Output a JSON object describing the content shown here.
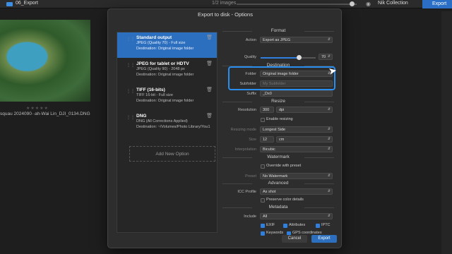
{
  "app": {
    "folder_name": "06_Export",
    "image_count": "1/2 images",
    "nik_label": "Nik Collection",
    "export_tab": "Export",
    "thumbnail_filename": "squau 2024090··ah-Wai Lin_DJI_0134.DNG",
    "thumbnail_stars": "★★★★★"
  },
  "dialog": {
    "title": "Export to disk - Options",
    "add_option": "Add New Option",
    "cancel_label": "Cancel",
    "export_label": "Export"
  },
  "presets": [
    {
      "name": "Standard output",
      "line1": "JPEG (Quality 70) - Full size",
      "line2": "Destination: Original image folder",
      "selected": true
    },
    {
      "name": "JPEG for tablet or HDTV",
      "line1": "JPEG (Quality 90) - 2048 px",
      "line2": "Destination: Original image folder",
      "selected": false
    },
    {
      "name": "TIFF (16-bits)",
      "line1": "TIFF 16-bit - Full size",
      "line2": "Destination: Original image folder",
      "selected": false
    },
    {
      "name": "DNG",
      "line1": "DNG (All Corrections Applied)",
      "line2": "Destination: ~/Volumes/Photo Library/You1",
      "selected": false
    }
  ],
  "format": {
    "section": "Format",
    "action_label": "Action",
    "action_value": "Export as JPEG",
    "quality_label": "Quality",
    "quality_value": "70",
    "quality_fraction": 0.7
  },
  "destination": {
    "section": "Destination",
    "folder_label": "Folder",
    "folder_value": "Original image folder",
    "subfolder_label": "Subfolder",
    "subfolder_placeholder": "My Subfolder",
    "suffix_label": "Suffix",
    "suffix_value": "_Dx0"
  },
  "resize": {
    "section": "Resize",
    "resolution_label": "Resolution",
    "resolution_value": "300",
    "resolution_unit": "dpi",
    "enable_label": "Enable resizing",
    "mode_label": "Resizing mode",
    "mode_value": "Longest Side",
    "size_label": "Size",
    "size_value": "12",
    "size_unit": "cm",
    "interp_label": "Interpolation",
    "interp_value": "Bicubic"
  },
  "watermark": {
    "section": "Watermark",
    "override_label": "Override with preset",
    "preset_label": "Preset",
    "preset_value": "No Watermark"
  },
  "advanced": {
    "section": "Advanced",
    "icc_label": "ICC Profile",
    "icc_value": "As shot",
    "preserve_label": "Preserve color details"
  },
  "metadata": {
    "section": "Metadata",
    "include_label": "Include",
    "include_value": "All",
    "exif": "EXIF",
    "attributes": "Attributes",
    "iptc": "IPTC",
    "keywords": "Keywords",
    "gps": "GPS coordinates"
  },
  "colors": {
    "accent": "#2c6fbf",
    "annotation": "#2a8df0"
  }
}
